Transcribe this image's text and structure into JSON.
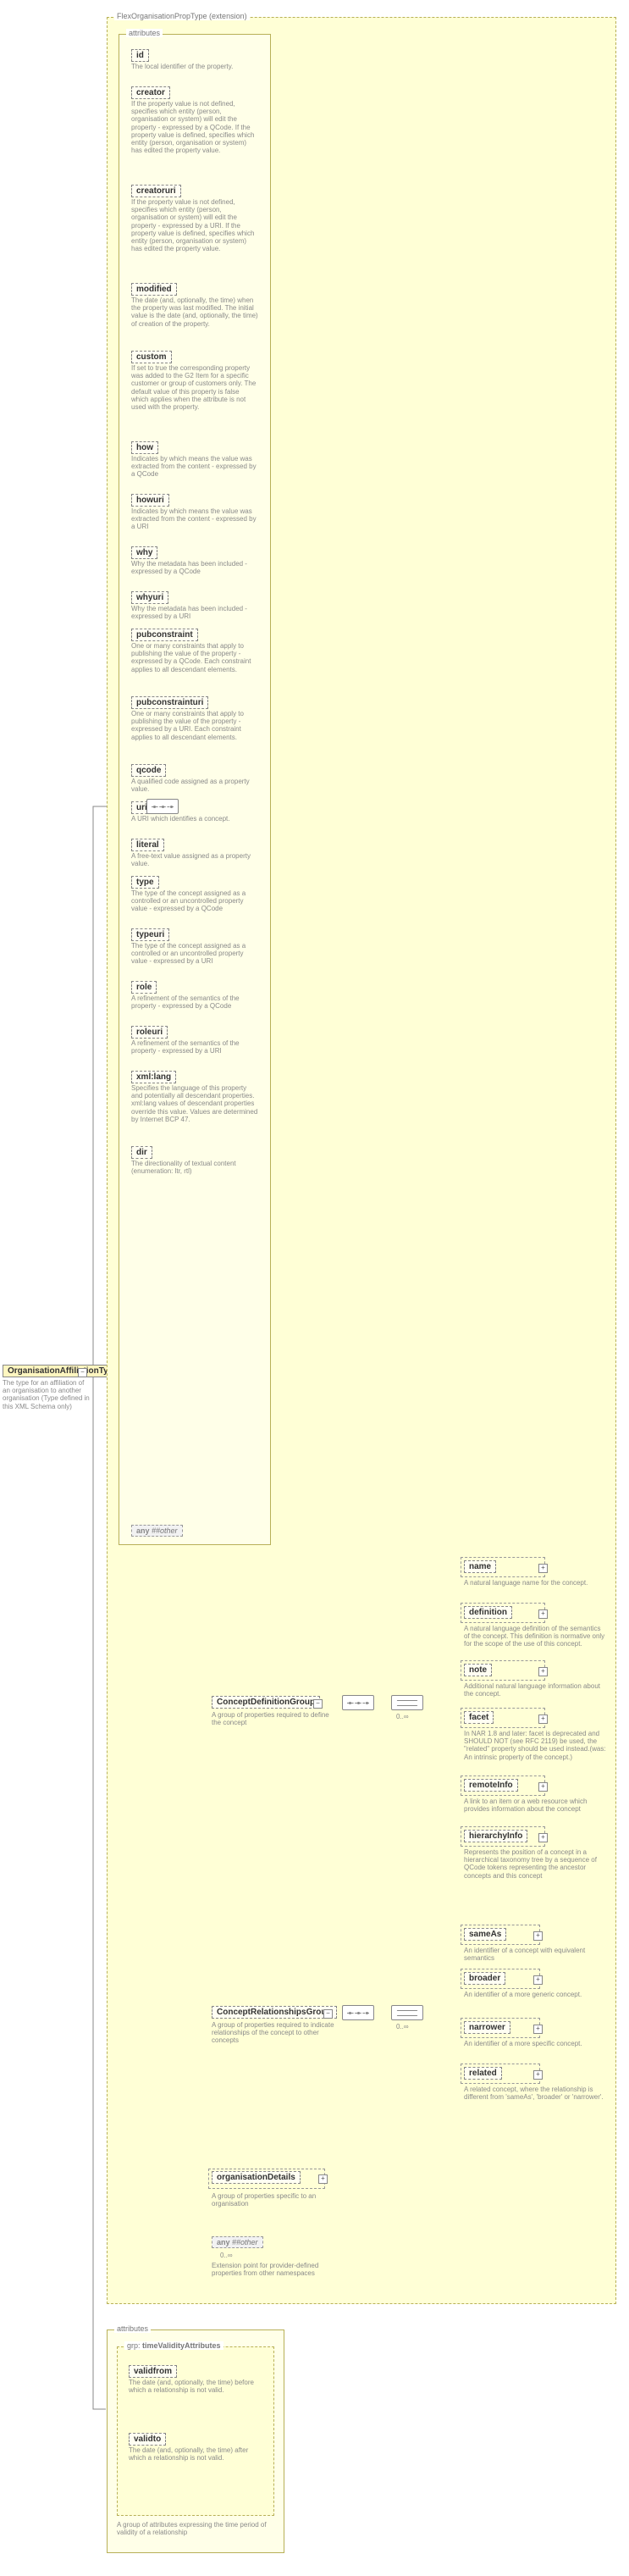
{
  "root": {
    "name": "OrganisationAffiliationType",
    "desc": "The type for an affiliation of an organisation to another organisation (Type defined in this XML Schema only)"
  },
  "ext_frame_label": "FlexOrganisationPropType (extension)",
  "attr_frame_label": "attributes",
  "attrs": [
    {
      "name": "id",
      "desc": "The local identifier of the property."
    },
    {
      "name": "creator",
      "desc": "If the property value is not defined, specifies which entity (person, organisation or system) will edit the property - expressed by a QCode. If the property value is defined, specifies which entity (person, organisation or system) has edited the property value."
    },
    {
      "name": "creatoruri",
      "desc": "If the property value is not defined, specifies which entity (person, organisation or system) will edit the property - expressed by a URI. If the property value is defined, specifies which entity (person, organisation or system) has edited the property value."
    },
    {
      "name": "modified",
      "desc": "The date (and, optionally, the time) when the property was last modified. The initial value is the date (and, optionally, the time) of creation of the property."
    },
    {
      "name": "custom",
      "desc": "If set to true the corresponding property was added to the G2 Item for a specific customer or group of customers only. The default value of this property is false which applies when the attribute is not used with the property."
    },
    {
      "name": "how",
      "desc": "Indicates by which means the value was extracted from the content - expressed by a QCode"
    },
    {
      "name": "howuri",
      "desc": "Indicates by which means the value was extracted from the content - expressed by a URI"
    },
    {
      "name": "why",
      "desc": "Why the metadata has been included - expressed by a QCode"
    },
    {
      "name": "whyuri",
      "desc": "Why the metadata has been included - expressed by a URI"
    },
    {
      "name": "pubconstraint",
      "desc": "One or many constraints that apply to publishing the value of the property - expressed by a QCode. Each constraint applies to all descendant elements."
    },
    {
      "name": "pubconstrainturi",
      "desc": "One or many constraints that apply to publishing the value of the property - expressed by a URI. Each constraint applies to all descendant elements."
    },
    {
      "name": "qcode",
      "desc": "A qualified code assigned as a property value."
    },
    {
      "name": "uri",
      "desc": "A URI which identifies a concept."
    },
    {
      "name": "literal",
      "desc": "A free-text value assigned as a property value."
    },
    {
      "name": "type",
      "desc": "The type of the concept assigned as a controlled or an uncontrolled property value - expressed by a QCode"
    },
    {
      "name": "typeuri",
      "desc": "The type of the concept assigned as a controlled or an uncontrolled property value - expressed by a URI"
    },
    {
      "name": "role",
      "desc": "A refinement of the semantics of the property - expressed by a QCode"
    },
    {
      "name": "roleuri",
      "desc": "A refinement of the semantics of the property - expressed by a URI"
    },
    {
      "name": "xml:lang",
      "desc": "Specifies the language of this property and potentially all descendant properties. xml:lang values of descendant properties override this value. Values are determined by Internet BCP 47."
    },
    {
      "name": "dir",
      "desc": "The directionality of textual content (enumeration: ltr, rtl)"
    }
  ],
  "any_attr": {
    "any": "any",
    "other": "##other"
  },
  "group1": {
    "label": "ConceptDefinitionGroup",
    "desc": "A group of properties required to define the concept"
  },
  "group2": {
    "label": "ConceptRelationshipsGroup",
    "desc": "A group of properties required to indicate relationships of the concept to other concepts"
  },
  "orgdetails": {
    "label": "organisationDetails",
    "desc": "A group of properties specific to an organisation"
  },
  "anyother": {
    "any": "any",
    "other": "##other",
    "mult": "0..∞",
    "desc": "Extension point for provider-defined properties from other namespaces"
  },
  "def_items": [
    {
      "name": "name",
      "desc": "A natural language name for the concept."
    },
    {
      "name": "definition",
      "desc": "A natural language definition of the semantics of the concept. This definition is normative only for the scope of the use of this concept."
    },
    {
      "name": "note",
      "desc": "Additional natural language information about the concept."
    },
    {
      "name": "facet",
      "desc": "In NAR 1.8 and later: facet is deprecated and SHOULD NOT (see RFC 2119) be used, the \"related\" property should be used instead.(was: An intrinsic property of the concept.)"
    },
    {
      "name": "remoteInfo",
      "desc": "A link to an item or a web resource which provides information about the concept"
    },
    {
      "name": "hierarchyInfo",
      "desc": "Represents the position of a concept in a hierarchical taxonomy tree by a sequence of QCode tokens representing the ancestor concepts and this concept"
    }
  ],
  "def_mult": "0..∞",
  "rel_items": [
    {
      "name": "sameAs",
      "desc": "An identifier of a concept with equivalent semantics"
    },
    {
      "name": "broader",
      "desc": "An identifier of a more generic concept."
    },
    {
      "name": "narrower",
      "desc": "An identifier of a more specific concept."
    },
    {
      "name": "related",
      "desc": "A related concept, where the relationship is different from 'sameAs', 'broader' or 'narrower'."
    }
  ],
  "rel_mult": "0..∞",
  "tv_frame_label": "attributes",
  "tv_group_label": "timeValidityAttributes",
  "tv_attrs": [
    {
      "name": "validfrom",
      "desc": "The date (and, optionally, the time) before which a relationship is not valid."
    },
    {
      "name": "validto",
      "desc": "The date (and, optionally, the time) after which a relationship is not valid."
    }
  ],
  "tv_group_desc": "A group of attributes expressing the time period of validity of a relationship",
  "grp_prefix": "grp:"
}
